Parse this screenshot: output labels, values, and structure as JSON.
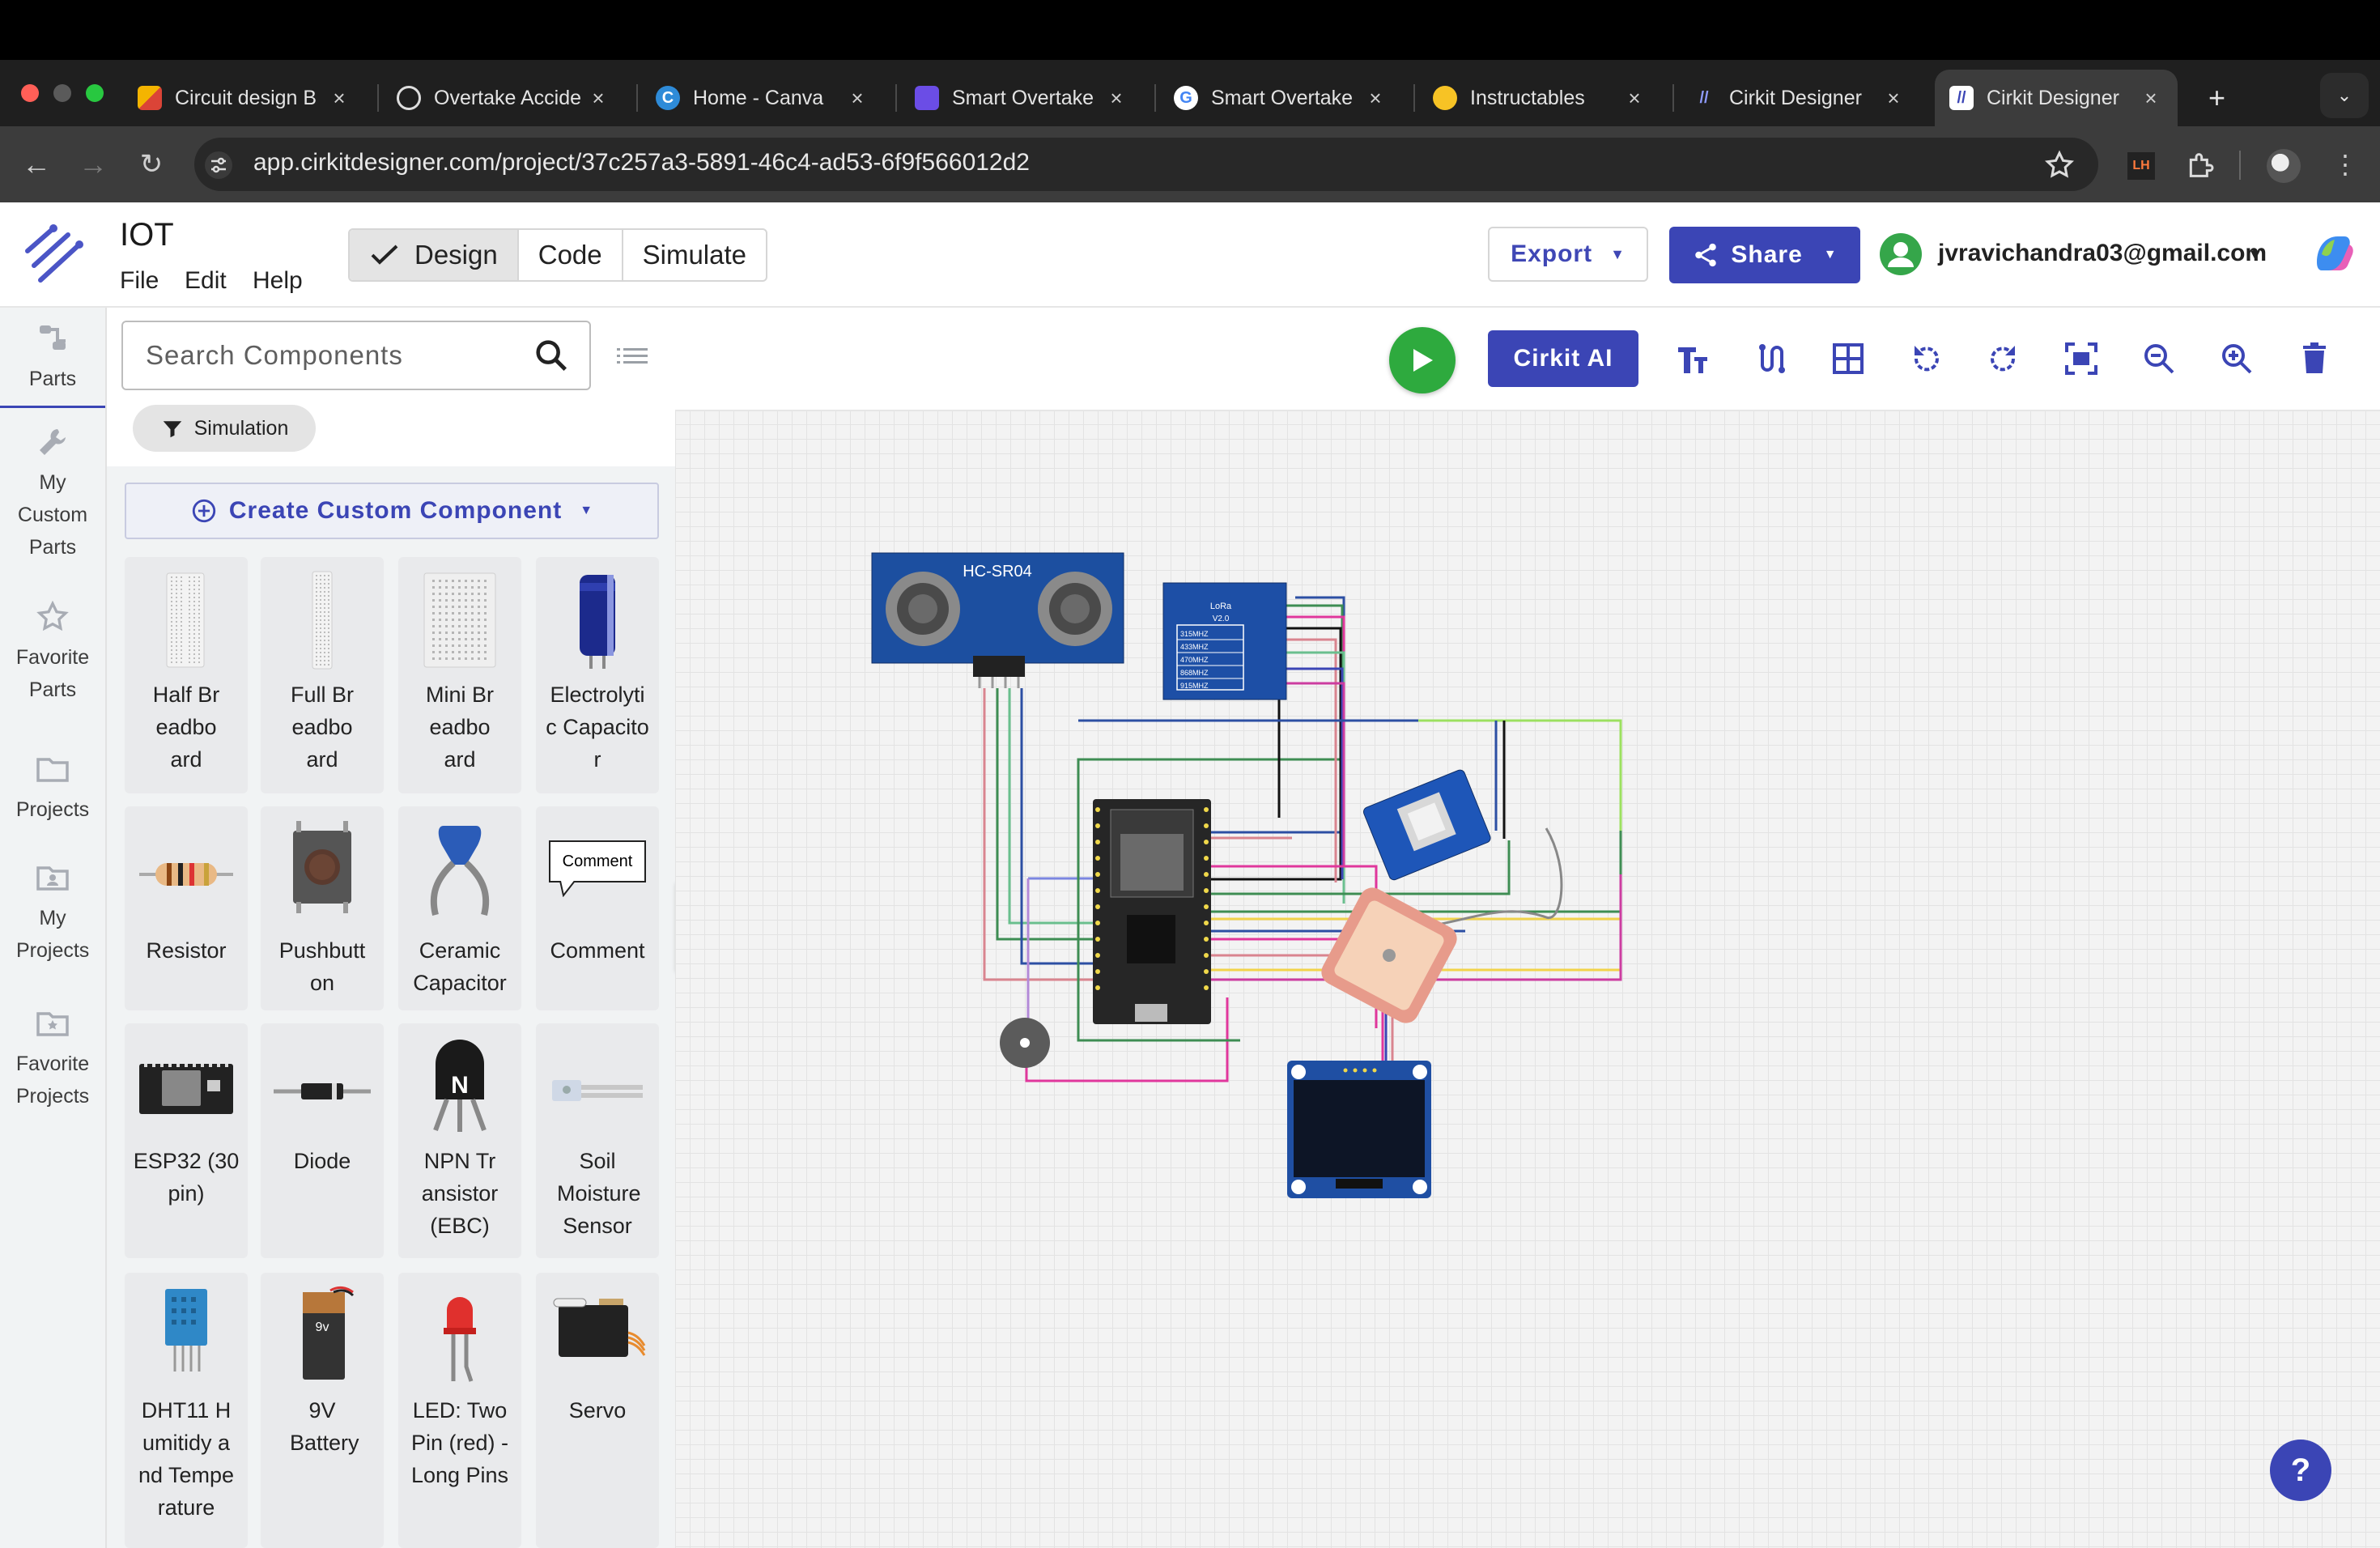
{
  "browser": {
    "tabs": [
      {
        "title": "Circuit design B",
        "favicon": "grid-favicon",
        "active": false
      },
      {
        "title": "Overtake Accide",
        "favicon": "openai-favicon",
        "active": false
      },
      {
        "title": "Home - Canva",
        "favicon": "canva-favicon",
        "active": false
      },
      {
        "title": "Smart Overtake",
        "favicon": "app-favicon",
        "active": false
      },
      {
        "title": "Smart Overtake",
        "favicon": "google-favicon",
        "active": false
      },
      {
        "title": "Instructables",
        "favicon": "instructables-favicon",
        "active": false
      },
      {
        "title": "Cirkit Designer",
        "favicon": "cirkit-favicon",
        "active": false
      },
      {
        "title": "Cirkit Designer",
        "favicon": "cirkit-favicon",
        "active": true
      }
    ],
    "new_tab": "+",
    "url": "app.cirkitdesigner.com/project/37c257a3-5891-46c4-ad53-6f9f566012d2"
  },
  "app": {
    "project_title": "IOT",
    "menu": [
      "File",
      "Edit",
      "Help"
    ],
    "modes": [
      "Design",
      "Code",
      "Simulate"
    ],
    "active_mode": "Design",
    "export_label": "Export",
    "share_label": "Share",
    "user_email": "jvravichandra03@gmail.com",
    "accent_color": "#3b45b5",
    "run_color": "#2eaa3e"
  },
  "rail": [
    {
      "label": "Parts",
      "icon": "parts-icon"
    },
    {
      "label": "My Custom Parts",
      "icon": "wrench-icon"
    },
    {
      "label": "Favorite Parts",
      "icon": "star-icon"
    },
    {
      "label": "Projects",
      "icon": "folder-icon"
    },
    {
      "label": "My Projects",
      "icon": "user-folder-icon"
    },
    {
      "label": "Favorite Projects",
      "icon": "star-folder-icon"
    }
  ],
  "panel": {
    "search_placeholder": "Search Components",
    "filter_label": "Simulation",
    "custom_component_label": "Create Custom Component",
    "parts": [
      {
        "label": "Half Breadboard",
        "icon": "half-breadboard-icon"
      },
      {
        "label": "Full Breadboard",
        "icon": "full-breadboard-icon"
      },
      {
        "label": "Mini Breadboard",
        "icon": "mini-breadboard-icon"
      },
      {
        "label": "Electrolytic Capacitor",
        "icon": "electrolytic-capacitor-icon"
      },
      {
        "label": "Resistor",
        "icon": "resistor-icon"
      },
      {
        "label": "Pushbutton",
        "icon": "pushbutton-icon"
      },
      {
        "label": "Ceramic Capacitor",
        "icon": "ceramic-capacitor-icon"
      },
      {
        "label": "Comment",
        "icon": "comment-icon"
      },
      {
        "label": "ESP32 (30 pin)",
        "icon": "esp32-icon"
      },
      {
        "label": "Diode",
        "icon": "diode-icon"
      },
      {
        "label": "NPN Transistor (EBC)",
        "icon": "npn-transistor-icon"
      },
      {
        "label": "Soil Moisture Sensor",
        "icon": "soil-moisture-icon"
      },
      {
        "label": "DHT11 Humitidy and Temperature",
        "icon": "dht11-icon"
      },
      {
        "label": "9V Battery",
        "icon": "battery-icon"
      },
      {
        "label": "LED: Two Pin (red) - Long Pins",
        "icon": "led-icon"
      },
      {
        "label": "Servo",
        "icon": "servo-icon"
      }
    ],
    "comment_preview_text": "Comment",
    "battery_text": "9v"
  },
  "canvas": {
    "ai_label": "Cirkit AI",
    "help_label": "?",
    "components": {
      "ultrasonic_label": "HC-SR04",
      "lora_label": "LoRa",
      "lora_version": "V2.0",
      "lora_freqs": [
        "315MHZ",
        "433MHZ",
        "470MHZ",
        "868MHZ",
        "915MHZ"
      ]
    }
  }
}
